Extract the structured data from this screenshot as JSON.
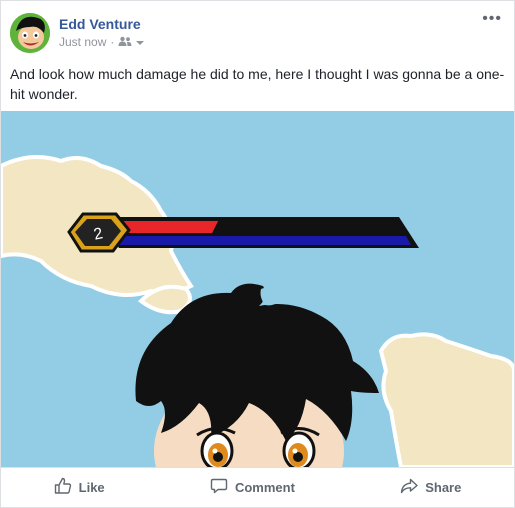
{
  "post": {
    "author": "Edd Venture",
    "timestamp": "Just now",
    "separator": "·",
    "audience_icon": "friends-icon",
    "audience_dropdown_icon": "caret-down-icon",
    "options_icon": "more-horizontal-icon",
    "options_glyph": "•••",
    "message": "And look how much damage he did to me, here I thought I was gonna be a one-hit wonder."
  },
  "image": {
    "health_badge": "2",
    "health_fill_fraction": 0.36,
    "sky_color": "#93cde5",
    "cloud_color": "#f2e7c2"
  },
  "actions": [
    {
      "label": "Like",
      "icon": "thumbs-up-icon"
    },
    {
      "label": "Comment",
      "icon": "comment-icon"
    },
    {
      "label": "Share",
      "icon": "share-icon"
    }
  ]
}
